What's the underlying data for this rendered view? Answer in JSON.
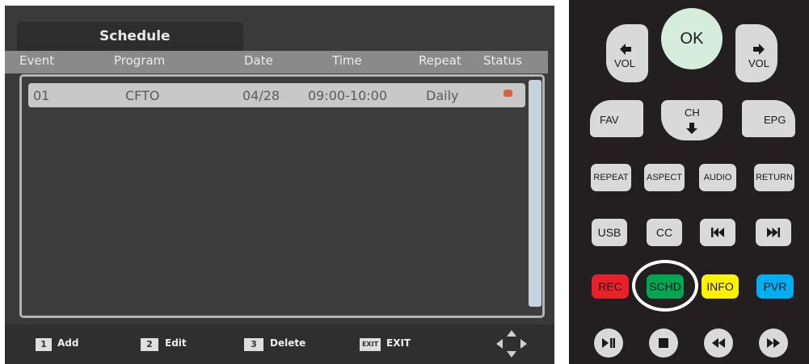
{
  "tv": {
    "tab_title": "Schedule",
    "columns": [
      "Event",
      "Program",
      "Date",
      "Time",
      "Repeat",
      "Status"
    ],
    "rows": [
      {
        "event": "01",
        "program": "CFTO",
        "date": "04/28",
        "time": "09:00-10:00",
        "repeat": "Daily",
        "status_icon": "record-icon"
      }
    ],
    "footer": [
      {
        "key": "1",
        "label": "Add"
      },
      {
        "key": "2",
        "label": "Edit"
      },
      {
        "key": "3",
        "label": "Delete"
      },
      {
        "key": "EXIT",
        "label": "EXIT"
      }
    ]
  },
  "remote": {
    "ok": "OK",
    "vol_left": "VOL",
    "vol_right": "VOL",
    "ch": "CH",
    "fav": "FAV",
    "epg": "EPG",
    "row3": [
      "REPEAT",
      "ASPECT",
      "AUDIO",
      "RETURN"
    ],
    "row4": [
      "USB",
      "CC"
    ],
    "row5": [
      "REC",
      "SCHD",
      "INFO",
      "PVR"
    ],
    "colors": {
      "rec": "#e8202a",
      "schd": "#00a651",
      "info": "#fff200",
      "pvr": "#00aeef",
      "ok": "#d6ecdc"
    }
  }
}
